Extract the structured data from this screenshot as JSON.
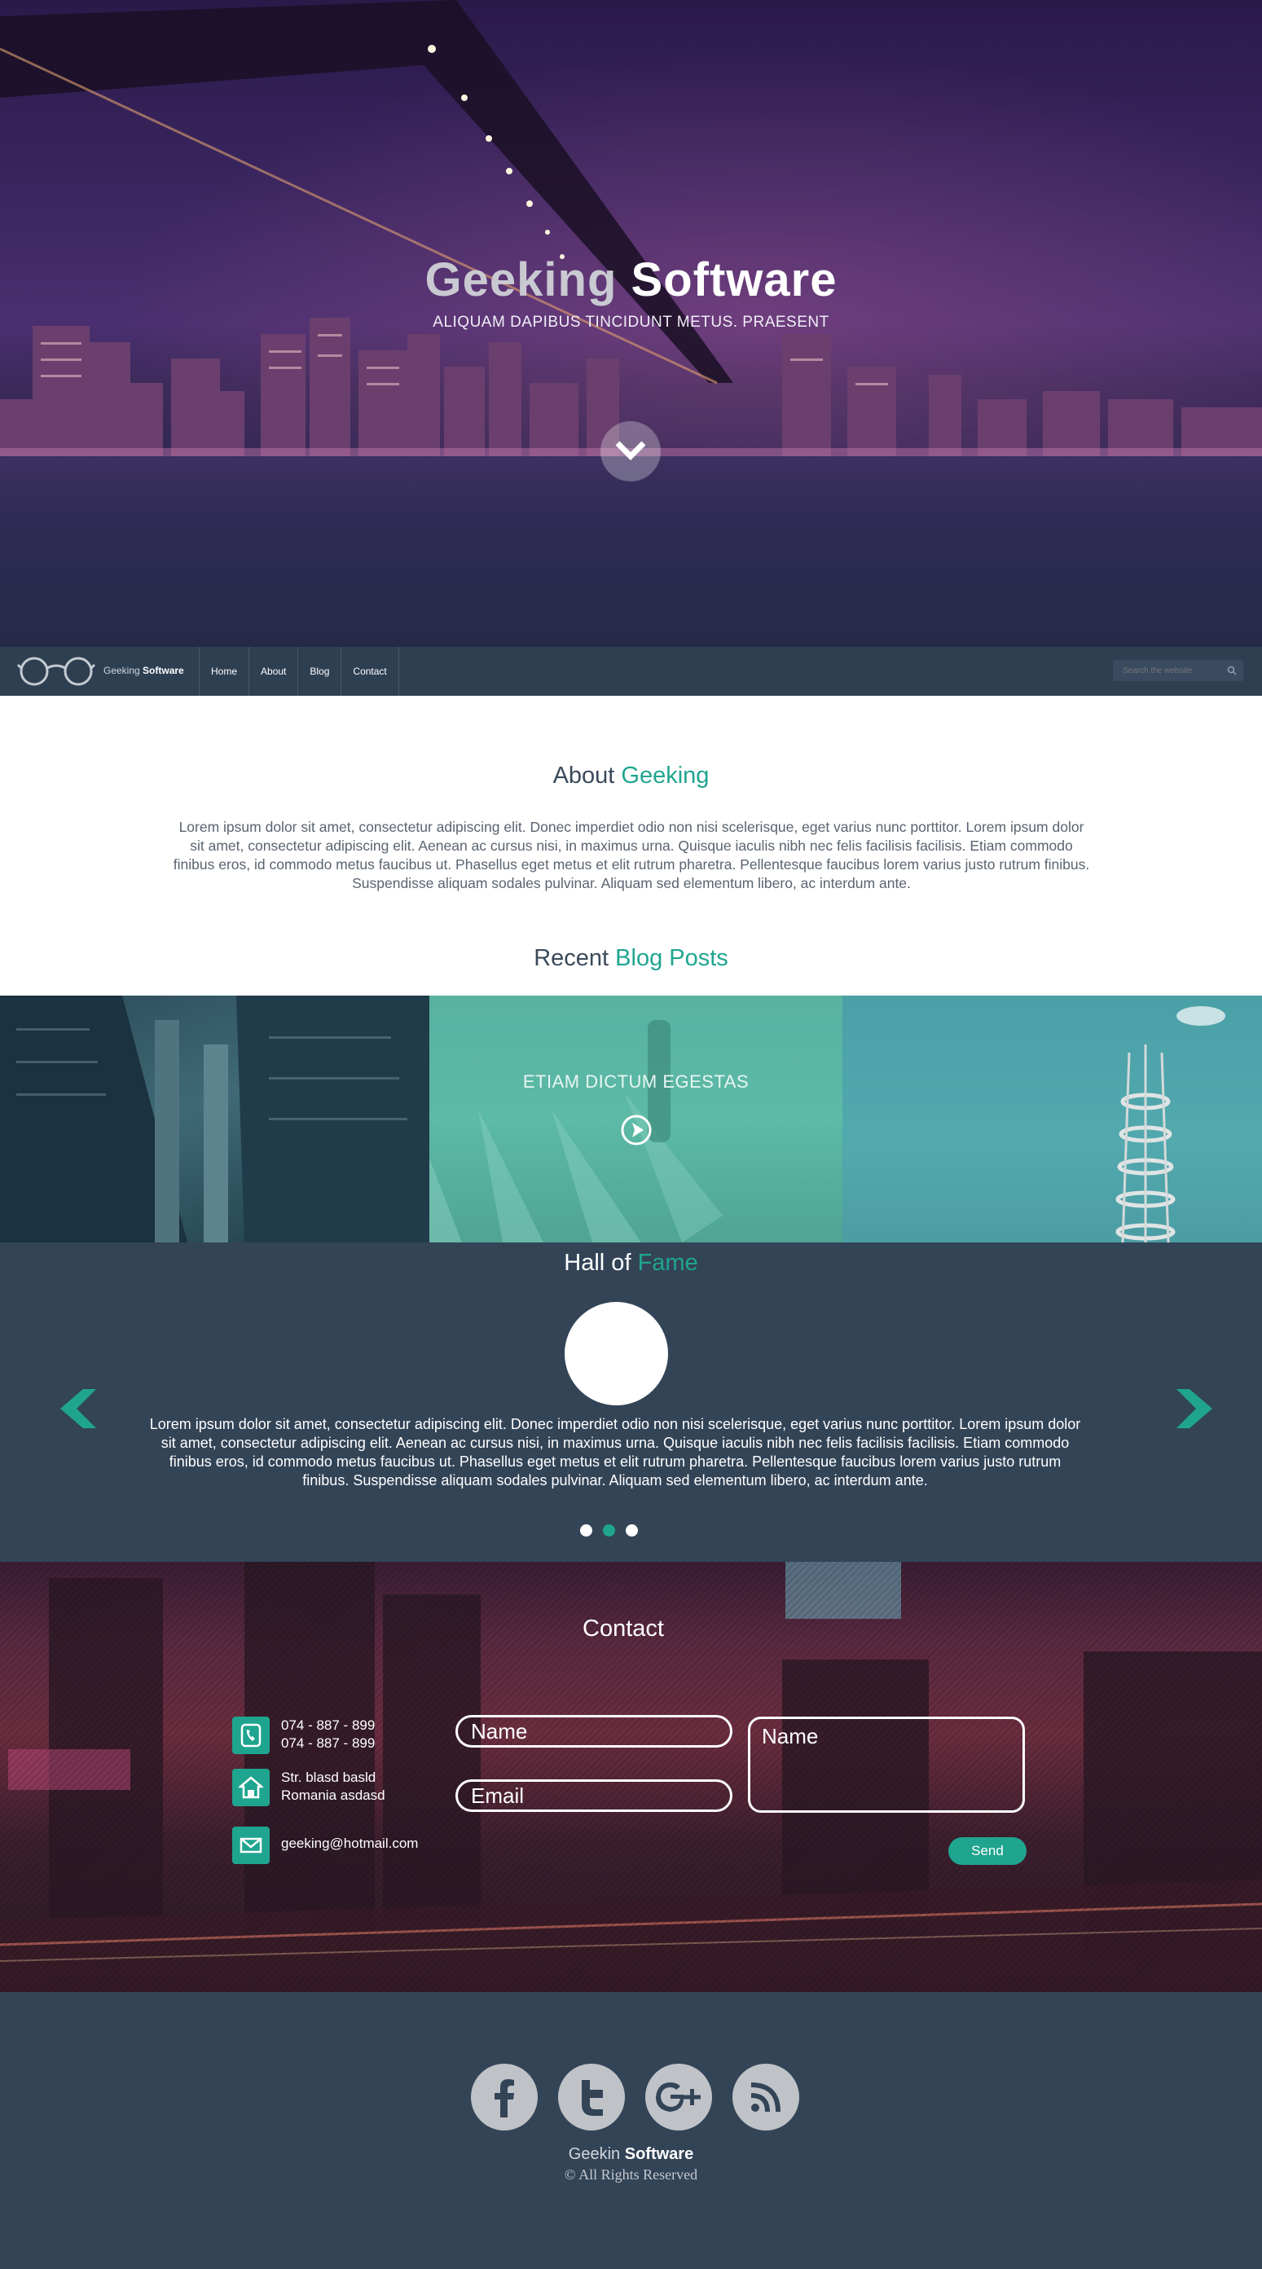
{
  "hero": {
    "title_part1": "Geeking",
    "title_part2": "Software",
    "subtitle": "ALIQUAM DAPIBUS TINCIDUNT METUS. PRAESENT",
    "scroll_icon": "chevron-down-icon"
  },
  "nav": {
    "logo_part1": "Geeking",
    "logo_part2": "Software",
    "items": [
      "Home",
      "About",
      "Blog",
      "Contact"
    ],
    "search_placeholder": "Search the website"
  },
  "about": {
    "heading_part1": "About",
    "heading_part2": "Geeking",
    "body": "Lorem ipsum dolor sit amet, consectetur adipiscing elit. Donec imperdiet odio non nisi scelerisque, eget varius nunc porttitor. Lorem ipsum dolor sit amet, consectetur adipiscing elit. Aenean ac cursus nisi, in maximus urna. Quisque iaculis nibh nec felis facilisis facilisis. Etiam commodo finibus eros, id commodo metus faucibus ut. Phasellus eget metus et elit rutrum pharetra. Pellentesque faucibus lorem varius justo rutrum finibus. Suspendisse aliquam sodales pulvinar. Aliquam sed elementum libero, ac interdum ante."
  },
  "blog": {
    "heading_part1": "Recent",
    "heading_part2": "Blog Posts",
    "featured_caption": "ETIAM DICTUM EGESTAS"
  },
  "fame": {
    "heading_part1": "Hall of",
    "heading_part2": "Fame",
    "body": "Lorem ipsum dolor sit amet, consectetur adipiscing elit. Donec imperdiet odio non nisi scelerisque, eget varius nunc porttitor. Lorem ipsum dolor sit amet, consectetur adipiscing elit. Aenean ac cursus nisi, in maximus urna. Quisque iaculis nibh nec felis facilisis facilisis. Etiam commodo finibus eros, id commodo metus faucibus ut. Phasellus eget metus et elit rutrum pharetra. Pellentesque faucibus lorem varius justo rutrum finibus. Suspendisse aliquam sodales pulvinar. Aliquam sed elementum libero, ac interdum ante.",
    "active_dot": 2
  },
  "contact": {
    "heading": "Contact",
    "phone_line1": "074 - 887 - 899",
    "phone_line2": "074 - 887 - 899",
    "address_line1": "Str. blasd basld",
    "address_line2": "Romania asdasd",
    "email": "geeking@hotmail.com",
    "name_placeholder": "Name",
    "email_placeholder": "Email",
    "message_placeholder": "Name",
    "send_label": "Send"
  },
  "footer": {
    "social_icons": [
      "facebook-icon",
      "twitter-icon",
      "google-plus-icon",
      "rss-icon"
    ],
    "brand_part1": "Geekin",
    "brand_part2": "Software",
    "rights": "© All Rights Reserved"
  },
  "colors": {
    "accent": "#1fa58f",
    "dark": "#334457",
    "nav": "#2f3f52"
  }
}
